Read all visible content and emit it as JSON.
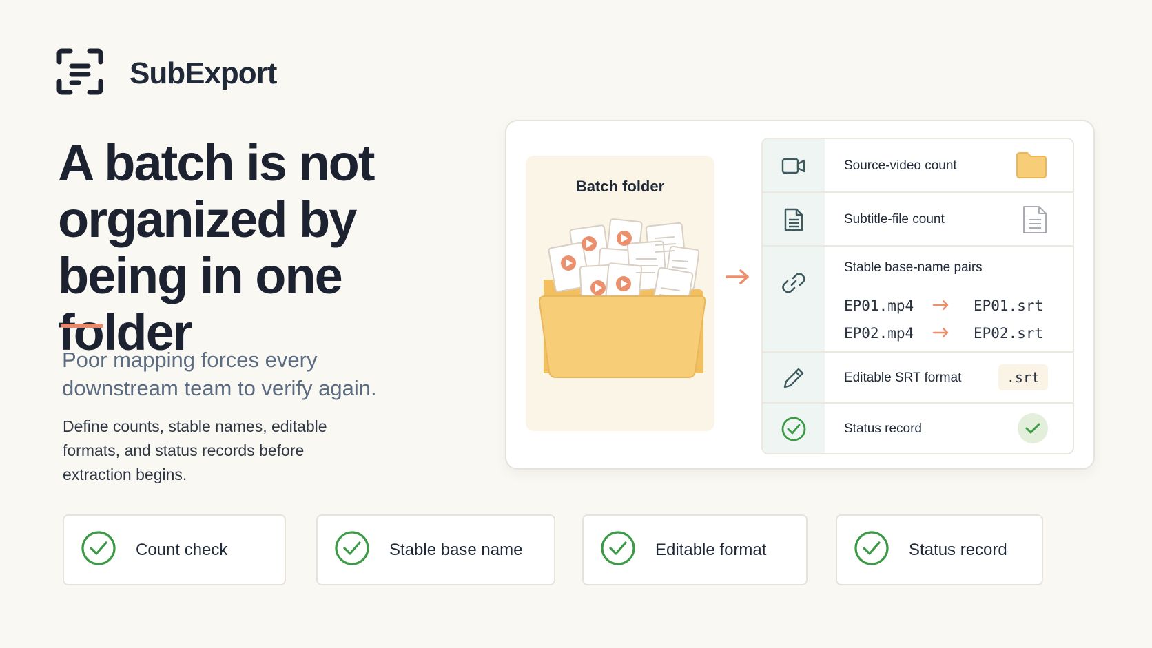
{
  "brand": {
    "name": "SubExport",
    "logo_icon": "bracket-lines-icon"
  },
  "headline": "A batch is not organized by being in one folder",
  "subhead": "Poor mapping forces every downstream team to verify again.",
  "body": "Define counts, stable names, editable formats, and status records before extraction begins.",
  "colors": {
    "accent": "#e9896b",
    "folder": "#f7cd78",
    "check": "#3b9a44",
    "rail": "#eef5f3",
    "headline": "#1c2230",
    "subhead": "#5b6b81"
  },
  "panel": {
    "folder_title": "Batch folder",
    "rows": [
      {
        "label": "Source-video count",
        "icon": "video-camera-icon",
        "end_icon": "folder-icon"
      },
      {
        "label": "Subtitle-file count",
        "icon": "document-icon",
        "end_icon": "document-icon"
      },
      {
        "label": "Stable base-name pairs",
        "icon": "link-icon",
        "pairs": [
          {
            "from": "EP01.mp4",
            "to": "EP01.srt"
          },
          {
            "from": "EP02.mp4",
            "to": "EP02.srt"
          }
        ]
      },
      {
        "label": "Editable SRT format",
        "icon": "pencil-icon",
        "chip": ".srt"
      },
      {
        "label": "Status record",
        "icon": "check-circle-icon",
        "end_icon": "checkmark-icon"
      }
    ]
  },
  "checks": [
    {
      "label": "Count check",
      "icon": "check-circle-icon"
    },
    {
      "label": "Stable base name",
      "icon": "check-circle-icon"
    },
    {
      "label": "Editable format",
      "icon": "check-circle-icon"
    },
    {
      "label": "Status record",
      "icon": "check-circle-icon"
    }
  ]
}
